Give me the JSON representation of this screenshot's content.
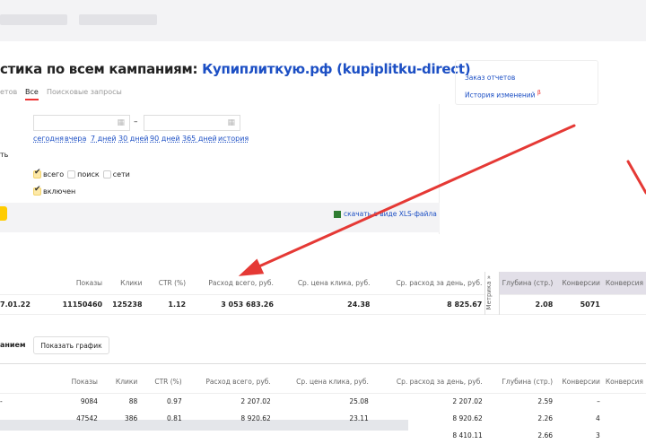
{
  "title": {
    "prefix": "стика по всем кампаниям: ",
    "link": "Купиплиткую.рф (kupiplitku-direct)"
  },
  "tabs": [
    {
      "label": "етов"
    },
    {
      "label": "Все"
    },
    {
      "label": "Поисковые запросы"
    }
  ],
  "date": {
    "separator": "–",
    "presets": [
      "сегодня",
      "вчера",
      "7 дней",
      "30 дней",
      "90 дней",
      "365 дней",
      "история"
    ]
  },
  "filters": {
    "label": "ть",
    "placement": [
      {
        "label": "всего",
        "checked": true
      },
      {
        "label": "поиск",
        "checked": false
      },
      {
        "label": "сети",
        "checked": false
      }
    ],
    "status": {
      "label": "включен",
      "checked": true
    }
  },
  "download": "скачать в виде XLS-файла",
  "side_links": [
    "Заказ отчетов",
    "История изменений"
  ],
  "side_badge": "β",
  "columns": [
    "Показы",
    "Клики",
    "CTR (%)",
    "Расход всего, руб.",
    "Ср. цена клика, руб.",
    "Ср. расход за день, руб.",
    "Глубина (стр.)",
    "Конверсии",
    "Конверсия"
  ],
  "metrika_label": "Метрика »",
  "summary": {
    "date": "7.01.22",
    "values": [
      "11150460",
      "125238",
      "1.12",
      "3 053 683.26",
      "24.38",
      "8 825.67",
      "2.08",
      "5071",
      ""
    ]
  },
  "campaigns": {
    "label": "анием",
    "show_chart": "Показать график",
    "rows": [
      {
        "name": "-",
        "values": [
          "9084",
          "88",
          "0.97",
          "2 207.02",
          "25.08",
          "2 207.02",
          "2.59",
          "–",
          ""
        ]
      },
      {
        "name": "",
        "values": [
          "47542",
          "386",
          "0.81",
          "8 920.62",
          "23.11",
          "8 920.62",
          "2.26",
          "4",
          ""
        ]
      },
      {
        "name": "",
        "values": [
          "",
          "",
          "",
          "",
          "",
          "8 410.11",
          "2.66",
          "3",
          ""
        ]
      }
    ]
  },
  "colors": {
    "link": "#1c4fc4",
    "accent": "#ffcc00",
    "arrow": "#e53935"
  }
}
